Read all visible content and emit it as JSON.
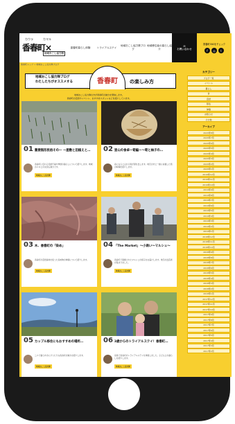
{
  "header": {
    "logo_ruby_left": "カウラ",
    "logo_ruby_right": "カマル",
    "logo_text": "香春町×",
    "logo_tag": "地域おこし協力隊",
    "nav": [
      {
        "label": "香春町暮らし体験"
      },
      {
        "label": "トライアルステイ"
      },
      {
        "label": "地域おこし協力隊ブログ"
      },
      {
        "label": "地域移住者の暮らし紹介"
      }
    ],
    "contact_label": "お問い合わせ",
    "sns_label": "香春町SNSをチェック",
    "sns_icons": [
      "f",
      "◎",
      "t"
    ]
  },
  "breadcrumb": "香春町トップ > 地域おこし協力隊ブログ",
  "banner": {
    "line1": "地域おこし協力隊ブログ",
    "line2": "わたしたちがオススメする",
    "town": "香春町",
    "suffix": "の楽しみ方",
    "desc1": "地域おこし協力隊の方が香春町の魅力を発信します。",
    "desc2": "香春町の自然やイベント、おすすめスポットなどを紹介しています。"
  },
  "posts": [
    {
      "num": "01",
      "title": "重要無形民俗その一 ー屋敷と田植えと…",
      "excerpt": "香春町に伝わる伝統行事や季節の暮らしについて紹介します。地域の人々との交流も魅力です。",
      "tag": "地域おこし協力隊"
    },
    {
      "num": "02",
      "title": "里山の食卓ー筍編ー〜筍と柚子の…",
      "excerpt": "春になると山から筍が顔を出します。地元の方と一緒に収穫した筍の料理を紹介します。",
      "tag": "地域おこし協力隊"
    },
    {
      "num": "03",
      "title": "木、香春町の「染め」",
      "excerpt": "香春町の自然素材を使った染め物の体験について紹介します。",
      "tag": "地域おこし協力隊"
    },
    {
      "num": "04",
      "title": "「The Market」〜小商い〜マルシェ〜",
      "excerpt": "香春町で開催されたマルシェの様子をお届けします。地元の出店者が集まりました。",
      "tag": "地域おこし協力隊"
    },
    {
      "num": "05",
      "title": "カップル移住にもおすすめの場所…",
      "excerpt": "二人で暮らすのにぴったりな香春町の魅力を紹介します。",
      "tag": "地域おこし協力隊"
    },
    {
      "num": "06",
      "title": "3歳からのトライアルステイ！香春町…",
      "excerpt": "家族で香春町のトライアルステイを体験しました。子どもとの暮らしを紹介します。",
      "tag": "地域おこし協力隊"
    }
  ],
  "sidebar": {
    "category_title": "カテゴリー",
    "categories": [
      "ブログ一覧",
      "イベント",
      "暮らし",
      "食",
      "自然",
      "移住",
      "体験",
      "お知らせ",
      "その他"
    ],
    "archive_title": "アーカイブ",
    "archives": [
      "2020年8月",
      "2020年7月",
      "2020年6月",
      "2020年5月",
      "2020年4月",
      "2020年3月",
      "2020年2月",
      "2020年1月",
      "2019年12月",
      "2019年11月",
      "2019年10月",
      "2019年9月",
      "2019年8月",
      "2019年7月",
      "2019年6月",
      "2019年5月",
      "2019年4月",
      "2019年3月",
      "2019年2月",
      "2019年1月",
      "2018年12月",
      "2018年11月",
      "2018年10月",
      "2018年9月",
      "2018年8月",
      "2018年7月",
      "2018年6月",
      "2018年5月",
      "2018年4月",
      "2018年3月",
      "2018年2月",
      "2018年1月",
      "2017年12月",
      "2017年11月",
      "2017年10月",
      "2017年9月",
      "2017年8月",
      "2017年7月",
      "2017年6月",
      "2017年5月",
      "2017年4月",
      "2017年3月",
      "2017年2月"
    ]
  }
}
